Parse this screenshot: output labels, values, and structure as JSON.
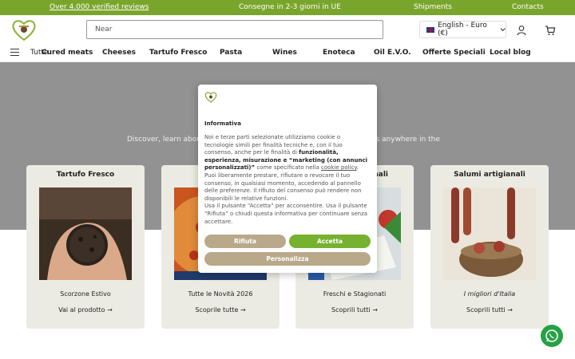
{
  "topbar": {
    "reviews": "Over 4.000 verified reviews",
    "delivery": "Consegne in 2-3 giorni in UE",
    "shipments": "Shipments",
    "contacts": "Contacts"
  },
  "header": {
    "search_placeholder": "Near",
    "language": "English - Euro (€)"
  },
  "nav": {
    "all": "Tutte",
    "items": [
      "Cured meats",
      "Cheeses",
      "Tartufo Fresco",
      "Pasta",
      "Wines",
      "Enoteca",
      "Oil E.V.O.",
      "Offerte Speciali",
      "Local blog"
    ]
  },
  "hero": {
    "text_left": "Discover, learn abou",
    "text_right": "cts anywhere in the"
  },
  "cards": [
    {
      "title": "Tartufo Fresco",
      "subtitle": "Scorzone Estivo",
      "link": "Vai al prodotto"
    },
    {
      "title": "",
      "subtitle": "Tutte le Novità 2026",
      "link": "Scoprile tutte"
    },
    {
      "title": "nali",
      "subtitle": "Freschi e Stagionati",
      "link": "Scoprili tutti"
    },
    {
      "title": "Salumi artigianali",
      "subtitle": "I migliori d'Italia",
      "link": "Scoprili tutti"
    }
  ],
  "modal": {
    "title": "Informativa",
    "p1_a": "Noi e terze parti selezionate utilizziamo cookie o tecnologie simili per finalità tecniche e, con il tuo consenso, anche per le finalità di ",
    "p1_b": "funzionalità, esperienza, misurazione e “marketing (con annunci personalizzati)”",
    "p1_c": " come specificato nella ",
    "p1_link": "cookie policy",
    "p1_d": ". Puoi liberamente prestare, rifiutare o revocare il tuo consenso, in qualsiasi momento, accedendo al pannello delle preferenze. Il rifiuto del consenso può rendere non disponibili le relative funzioni.",
    "p2": "Usa il pulsante “Accetta” per acconsentire. Usa il pulsante “Rifiuta” o chiudi questa informativa per continuare senza accettare.",
    "refuse": "Rifiuta",
    "accept": "Accetta",
    "customize": "Personalizza"
  },
  "colors": {
    "topbar": "#7aa52c",
    "hero_overlay": "#929292",
    "card_bg": "#ecebe3",
    "accept": "#76b130",
    "secondary": "#b9a98a",
    "whatsapp": "#25a244"
  },
  "icons": [
    "logo-heart-icon",
    "flag-uk-icon",
    "chevron-down-icon",
    "user-icon",
    "cart-icon",
    "menu-icon",
    "arrow-right-icon",
    "whatsapp-icon"
  ]
}
